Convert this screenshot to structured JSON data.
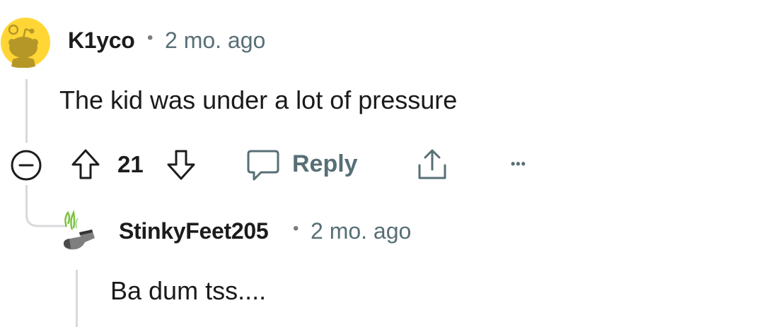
{
  "comments": [
    {
      "username": "K1yco",
      "separator": "•",
      "time": "2 mo. ago",
      "body": "The kid was under a lot of pressure",
      "score": "21",
      "reply_label": "Reply",
      "more_label": "•••"
    },
    {
      "username": "StinkyFeet205",
      "separator": "•",
      "time": "2 mo. ago",
      "body": "Ba dum tss...."
    }
  ],
  "colors": {
    "avatar_bg": "#ffd635",
    "snoo": "#b59728",
    "thread_line": "#d7dadc",
    "meta_text": "#576f76",
    "sock": "#7f7f7f",
    "stink": "#7dc242"
  },
  "icons": [
    "snoo-avatar-icon",
    "collapse-minus-icon",
    "upvote-arrow-icon",
    "downvote-arrow-icon",
    "comment-bubble-icon",
    "share-icon",
    "more-options-icon",
    "sock-avatar-icon"
  ]
}
